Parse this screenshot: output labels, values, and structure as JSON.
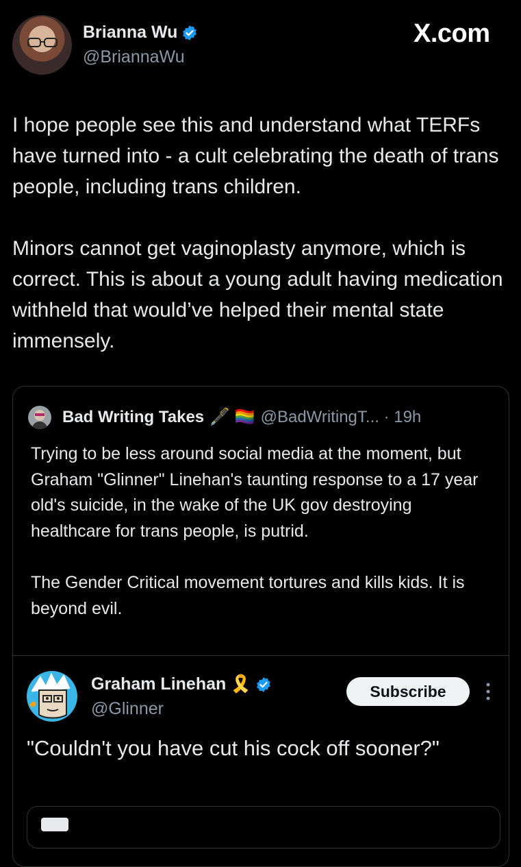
{
  "header": {
    "author_name": "Brianna Wu",
    "author_handle": "@BriannaWu",
    "site_logo_text": "X.com"
  },
  "tweet": {
    "paragraphs": [
      "I hope people see this and understand what TERFs have turned into - a cult celebrating the death of trans people, including trans children.",
      "Minors cannot get vaginoplasty anymore, which is correct. This is about a young adult having medication withheld that would’ve helped their mental state immensely."
    ]
  },
  "quoted_tweet": {
    "author_name": "Bad Writing Takes",
    "author_emojis": "🖋️ 🏳️‍🌈",
    "author_handle_time": "@BadWritingT... · 19h",
    "paragraphs": [
      "Trying to be less around social media at the moment, but Graham \"Glinner\" Linehan's taunting response to a 17 year old's suicide, in the wake of the UK gov destroying healthcare for trans people, is putrid.",
      "The Gender Critical movement tortures and kills kids. It is beyond evil."
    ]
  },
  "embedded_post": {
    "author_name": "Graham Linehan",
    "author_emoji": "🎗️",
    "author_handle": "@Glinner",
    "subscribe_label": "Subscribe",
    "text": "\"Couldn't you have cut his cock off sooner?\""
  },
  "colors": {
    "background": "#000000",
    "text": "#e7e9ea",
    "muted": "#8b98a5",
    "verified": "#1d9bf0",
    "border": "#2f3336"
  }
}
